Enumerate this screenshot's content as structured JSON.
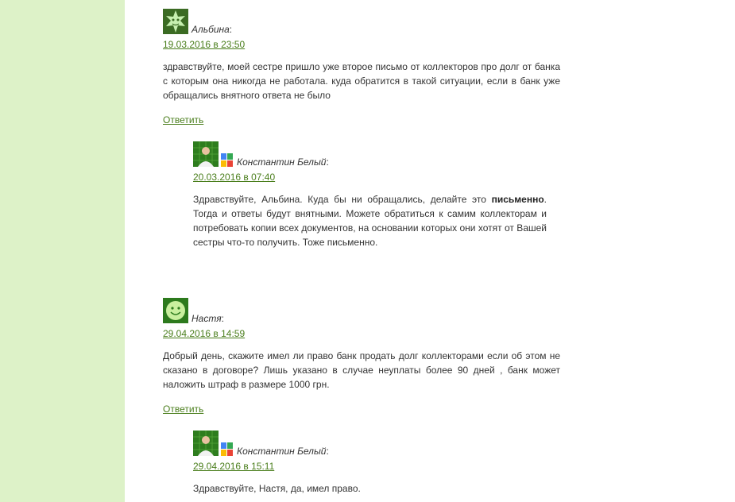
{
  "comments": [
    {
      "author": "Альбина",
      "date": "19.03.2016 в 23:50",
      "text": "здравствуйте, моей сестре пришло уже второе письмо от коллекторов про долг от банка с которым она никогда не работала. куда обратится в такой ситуации, если в банк уже обращались внятного ответа не было",
      "reply_label": "Ответить",
      "avatar_icon": "green-star-avatar-icon",
      "reply": {
        "author": "Константин Белый",
        "date": "20.03.2016 в 07:40",
        "text_before": "Здравствуйте, Альбина. Куда бы ни обращались, делайте это ",
        "text_bold": "письменно",
        "text_after": ". Тогда и ответы будут внятными. Можете обратиться к самим коллекторам и потребовать копии всех документов, на основании которых они хотят от Вашей сестры что-то получить. Тоже письменно.",
        "avatar_icon": "photo-avatar-icon",
        "badge_icon": "google-plus-icon"
      }
    },
    {
      "author": "Настя",
      "date": "29.04.2016 в 14:59",
      "text": "Добрый день, скажите имел ли право банк продать долг коллекторами если об этом не сказано в договоре? Лишь указано в случае неуплаты более 90 дней , банк может наложить штраф в размере 1000 грн.",
      "reply_label": "Ответить",
      "avatar_icon": "smiley-avatar-icon",
      "reply": {
        "author": "Константин Белый",
        "date": "29.04.2016 в 15:11",
        "text": "Здравствуйте, Настя, да, имел право.",
        "avatar_icon": "photo-avatar-icon",
        "badge_icon": "google-plus-icon"
      }
    }
  ],
  "colors": {
    "sidebar": "#ddf2c8",
    "link": "#4a7e1c",
    "text": "#333333"
  }
}
